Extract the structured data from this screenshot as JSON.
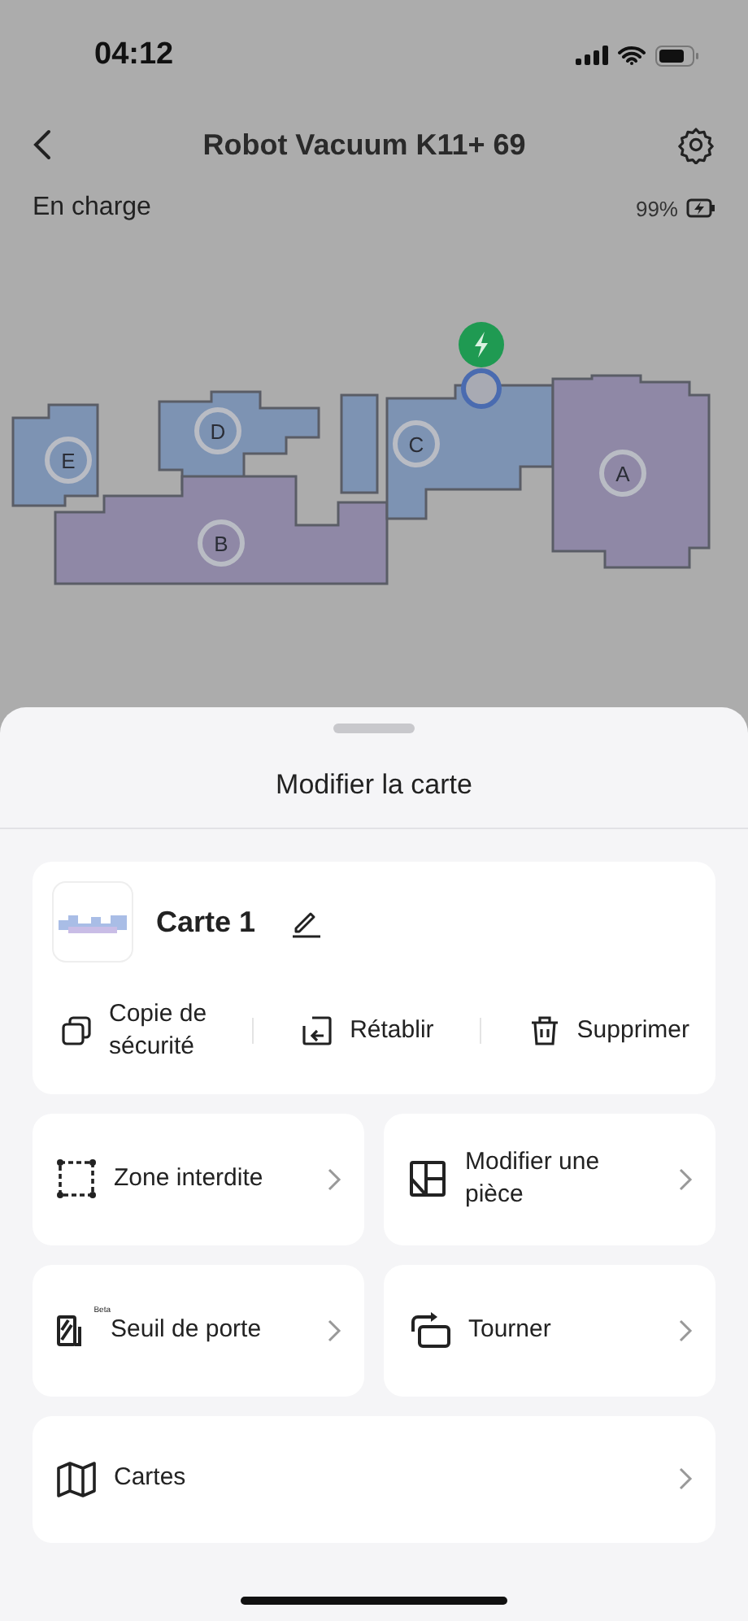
{
  "status_bar": {
    "time": "04:12"
  },
  "header": {
    "title": "Robot Vacuum K11+ 69"
  },
  "device": {
    "state": "En charge",
    "battery": "99%"
  },
  "map": {
    "rooms": [
      {
        "label": "E",
        "color": "#7d93b3"
      },
      {
        "label": "D",
        "color": "#7d93b3"
      },
      {
        "label": "C",
        "color": "#7d93b3"
      },
      {
        "label": "B",
        "color": "#8f88a6"
      },
      {
        "label": "A",
        "color": "#8f88a6"
      }
    ]
  },
  "sheet": {
    "title": "Modifier la carte",
    "map_card": {
      "name": "Carte 1",
      "actions": [
        {
          "kind": "copy",
          "label": "Copie de\nsécurité"
        },
        {
          "kind": "restore",
          "label": "Rétablir"
        },
        {
          "kind": "delete",
          "label": "Supprimer"
        }
      ]
    },
    "tiles": [
      {
        "kind": "zone",
        "label": "Zone interdite"
      },
      {
        "kind": "room",
        "label": "Modifier une\npièce"
      },
      {
        "kind": "threshold",
        "label": "Seuil de porte",
        "badge": "Beta"
      },
      {
        "kind": "rotate",
        "label": "Tourner"
      }
    ],
    "maps_row": {
      "label": "Cartes"
    }
  }
}
